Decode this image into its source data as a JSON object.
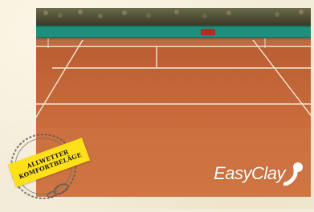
{
  "photo": {
    "subject": "clay tennis court",
    "colors": {
      "clay": "#c8693a",
      "clay_dark": "#b45a2f",
      "line": "#f2e6d8",
      "windscreen": "#1f8f7f",
      "stands": "#3a3a2a"
    }
  },
  "brand": {
    "name": "EasyClay",
    "mark_icon": "ball-swoosh-icon",
    "color": "#ffffff"
  },
  "seal": {
    "line1": "ALLWETTER",
    "line2": "KOMFORTBELÄGE",
    "banner_color": "#ffe11a",
    "icon": "shoe-print-stamp-icon"
  }
}
